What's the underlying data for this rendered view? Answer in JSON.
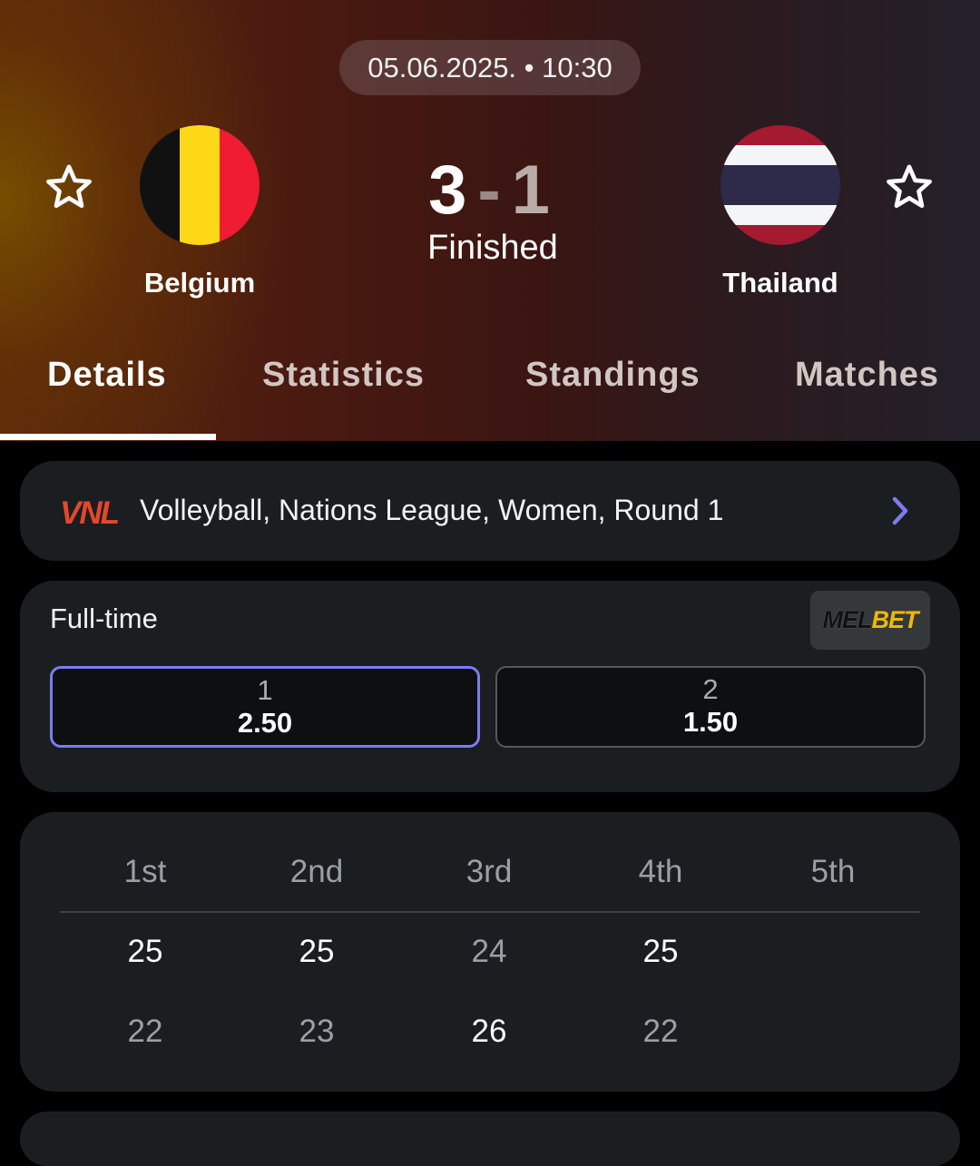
{
  "match": {
    "datetime": "05.06.2025. • 10:30",
    "home_team": "Belgium",
    "away_team": "Thailand",
    "home_score": "3",
    "separator": "-",
    "away_score": "1",
    "status": "Finished"
  },
  "tabs": [
    {
      "label": "Details",
      "active": true
    },
    {
      "label": "Statistics",
      "active": false
    },
    {
      "label": "Standings",
      "active": false
    },
    {
      "label": "Matches",
      "active": false
    }
  ],
  "league": {
    "logo_text": "VNL",
    "name": "Volleyball, Nations League, Women, Round 1"
  },
  "odds": {
    "title": "Full-time",
    "bookmaker_prefix": "MEL",
    "bookmaker_suffix": "BET",
    "options": [
      {
        "label": "1",
        "value": "2.50",
        "selected": true
      },
      {
        "label": "2",
        "value": "1.50",
        "selected": false
      }
    ]
  },
  "sets": {
    "headers": [
      "1st",
      "2nd",
      "3rd",
      "4th",
      "5th"
    ],
    "home": [
      "25",
      "25",
      "24",
      "25",
      ""
    ],
    "away": [
      "22",
      "23",
      "26",
      "22",
      ""
    ]
  },
  "colors": {
    "accent": "#7c7cf0",
    "card_bg": "#1b1e21",
    "vnl_red": "#e4472d",
    "melbet_yellow": "#f2b705"
  },
  "icons": [
    "star-icon",
    "chevron-right-icon"
  ]
}
